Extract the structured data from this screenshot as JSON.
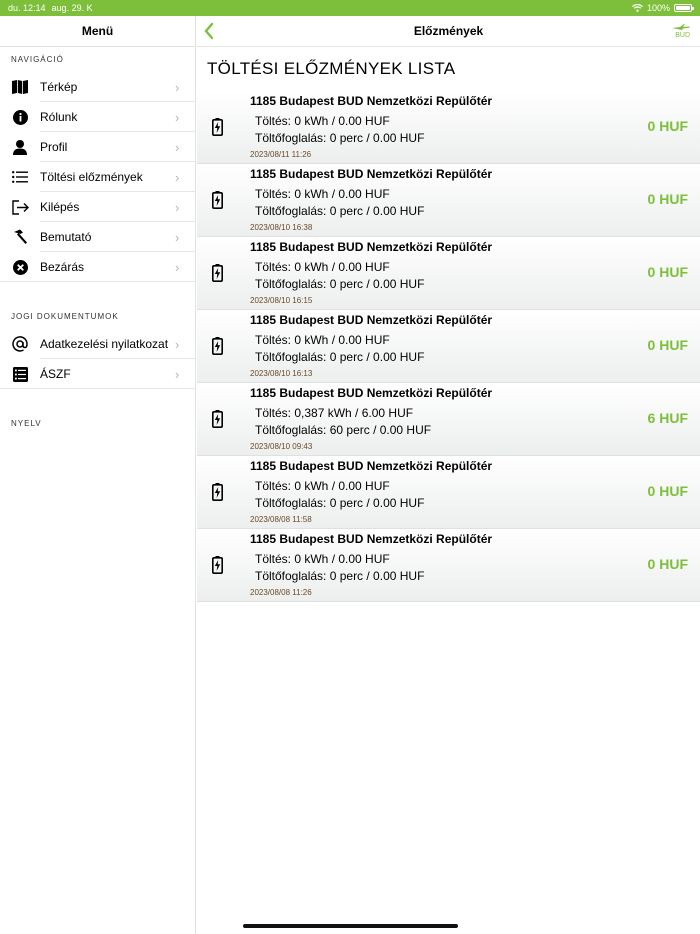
{
  "status": {
    "time": "du. 12:14",
    "date": "aug. 29. K",
    "battery": "100%"
  },
  "sidebar": {
    "title": "Menü",
    "nav_label": "NAVIGÁCIÓ",
    "nav_items": [
      {
        "label": "Térkép",
        "icon": "map-icon"
      },
      {
        "label": "Rólunk",
        "icon": "info-icon"
      },
      {
        "label": "Profil",
        "icon": "person-icon"
      },
      {
        "label": "Töltési előzmények",
        "icon": "list-icon"
      },
      {
        "label": "Kilépés",
        "icon": "logout-icon"
      },
      {
        "label": "Bemutató",
        "icon": "hammer-icon"
      },
      {
        "label": "Bezárás",
        "icon": "close-icon"
      }
    ],
    "legal_label": "JOGI DOKUMENTUMOK",
    "legal_items": [
      {
        "label": "Adatkezelési nyilatkozat",
        "icon": "at-icon"
      },
      {
        "label": "ÁSZF",
        "icon": "document-list-icon"
      }
    ],
    "language_label": "NYELV"
  },
  "header": {
    "title": "Előzmények",
    "logo_text": "BUD"
  },
  "main": {
    "list_title": "TÖLTÉSI ELŐZMÉNYEK LISTA",
    "rows": [
      {
        "location": "1185 Budapest BUD Nemzetközi Repülőtér",
        "charge": "Töltés: 0 kWh / 0.00 HUF",
        "booking": "Töltőfoglalás: 0 perc / 0.00 HUF",
        "date": "2023/08/11 11:26",
        "price": "0 HUF"
      },
      {
        "location": "1185 Budapest BUD Nemzetközi Repülőtér",
        "charge": "Töltés: 0 kWh / 0.00 HUF",
        "booking": "Töltőfoglalás: 0 perc / 0.00 HUF",
        "date": "2023/08/10 16:38",
        "price": "0 HUF"
      },
      {
        "location": "1185 Budapest BUD Nemzetközi Repülőtér",
        "charge": "Töltés: 0 kWh / 0.00 HUF",
        "booking": "Töltőfoglalás: 0 perc / 0.00 HUF",
        "date": "2023/08/10 16:15",
        "price": "0 HUF"
      },
      {
        "location": "1185 Budapest BUD Nemzetközi Repülőtér",
        "charge": "Töltés: 0 kWh / 0.00 HUF",
        "booking": "Töltőfoglalás: 0 perc / 0.00 HUF",
        "date": "2023/08/10 16:13",
        "price": "0 HUF"
      },
      {
        "location": "1185 Budapest BUD Nemzetközi Repülőtér",
        "charge": "Töltés: 0,387 kWh / 6.00 HUF",
        "booking": "Töltőfoglalás: 60 perc / 0.00 HUF",
        "date": "2023/08/10 09:43",
        "price": "6 HUF"
      },
      {
        "location": "1185 Budapest BUD Nemzetközi Repülőtér",
        "charge": "Töltés: 0 kWh / 0.00 HUF",
        "booking": "Töltőfoglalás: 0 perc / 0.00 HUF",
        "date": "2023/08/08 11:58",
        "price": "0 HUF"
      },
      {
        "location": "1185 Budapest BUD Nemzetközi Repülőtér",
        "charge": "Töltés: 0 kWh / 0.00 HUF",
        "booking": "Töltőfoglalás: 0 perc / 0.00 HUF",
        "date": "2023/08/08 11:26",
        "price": "0 HUF"
      }
    ]
  },
  "colors": {
    "accent": "#7dbf3a",
    "date": "#6b4a2a"
  }
}
